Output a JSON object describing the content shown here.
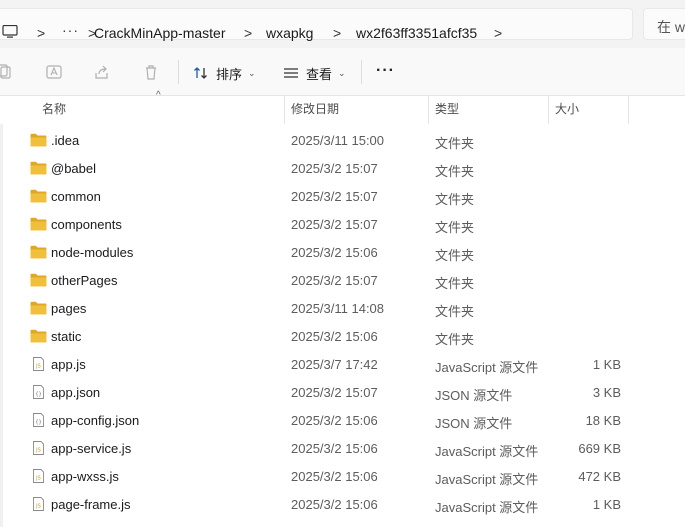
{
  "address": {
    "crumbs": [
      "CrackMinApp-master",
      "wxapkg",
      "wx2f63ff3351afcf35"
    ],
    "more_glyph": "···",
    "separator": ">",
    "search_placeholder": "在 wx"
  },
  "toolbar": {
    "sort_label": "排序",
    "view_label": "查看",
    "more_glyph": "···",
    "chevron": "⌄"
  },
  "columns": {
    "name": "名称",
    "date": "修改日期",
    "type": "类型",
    "size": "大小",
    "sort_caret": "^"
  },
  "files": [
    {
      "name": ".idea",
      "date": "2025/3/11 15:00",
      "type": "文件夹",
      "size": "",
      "kind": "folder"
    },
    {
      "name": "@babel",
      "date": "2025/3/2 15:07",
      "type": "文件夹",
      "size": "",
      "kind": "folder"
    },
    {
      "name": "common",
      "date": "2025/3/2 15:07",
      "type": "文件夹",
      "size": "",
      "kind": "folder"
    },
    {
      "name": "components",
      "date": "2025/3/2 15:07",
      "type": "文件夹",
      "size": "",
      "kind": "folder"
    },
    {
      "name": "node-modules",
      "date": "2025/3/2 15:06",
      "type": "文件夹",
      "size": "",
      "kind": "folder"
    },
    {
      "name": "otherPages",
      "date": "2025/3/2 15:07",
      "type": "文件夹",
      "size": "",
      "kind": "folder"
    },
    {
      "name": "pages",
      "date": "2025/3/11 14:08",
      "type": "文件夹",
      "size": "",
      "kind": "folder"
    },
    {
      "name": "static",
      "date": "2025/3/2 15:06",
      "type": "文件夹",
      "size": "",
      "kind": "folder"
    },
    {
      "name": "app.js",
      "date": "2025/3/7 17:42",
      "type": "JavaScript 源文件",
      "size": "1 KB",
      "kind": "js"
    },
    {
      "name": "app.json",
      "date": "2025/3/2 15:07",
      "type": "JSON 源文件",
      "size": "3 KB",
      "kind": "json"
    },
    {
      "name": "app-config.json",
      "date": "2025/3/2 15:06",
      "type": "JSON 源文件",
      "size": "18 KB",
      "kind": "json"
    },
    {
      "name": "app-service.js",
      "date": "2025/3/2 15:06",
      "type": "JavaScript 源文件",
      "size": "669 KB",
      "kind": "js"
    },
    {
      "name": "app-wxss.js",
      "date": "2025/3/2 15:06",
      "type": "JavaScript 源文件",
      "size": "472 KB",
      "kind": "js"
    },
    {
      "name": "page-frame.js",
      "date": "2025/3/2 15:06",
      "type": "JavaScript 源文件",
      "size": "1 KB",
      "kind": "js"
    }
  ],
  "colors": {
    "folder": "#f0c03c",
    "folder_dark": "#e0a82a",
    "file_border": "#8a8a8a"
  }
}
